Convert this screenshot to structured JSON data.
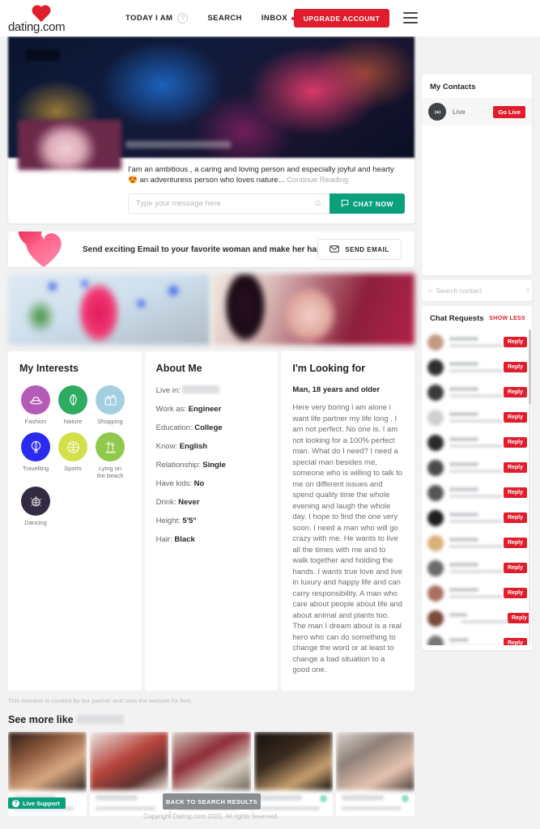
{
  "header": {
    "brand": "dating.com",
    "nav": [
      {
        "label": "TODAY I AM",
        "has_help": true
      },
      {
        "label": "SEARCH",
        "has_help": false
      },
      {
        "label": "INBOX",
        "has_help": false,
        "has_dot": true
      }
    ],
    "upgrade_label": "UPGRADE ACCOUNT"
  },
  "profile": {
    "bio": "I'am an ambitious , a caring and loving person and especially joyful and hearty 😍 an adventuress person who loves nature...",
    "continue_label": "Continue Reading",
    "message_placeholder": "Type your message here",
    "message_value": "",
    "chat_button": "CHAT NOW"
  },
  "email_banner": {
    "text": "Send exciting Email to your favorite woman and make her happy!",
    "button": "SEND EMAIL"
  },
  "interests": {
    "title": "My Interests",
    "items": [
      {
        "label": "Fashion",
        "icon": "hat-icon",
        "color": "#b45bb8"
      },
      {
        "label": "Nature",
        "icon": "leaf-icon",
        "color": "#2eab61"
      },
      {
        "label": "Shopping",
        "icon": "shopping-bags-icon",
        "color": "#a3cfe0"
      },
      {
        "label": "Travelling",
        "icon": "hot-air-balloon-icon",
        "color": "#2b2bf0"
      },
      {
        "label": "Sports",
        "icon": "ball-icon",
        "color": "#d3e04a"
      },
      {
        "label": "Lying on the beach",
        "icon": "palm-tree-icon",
        "color": "#8fc84a"
      },
      {
        "label": "Dancing",
        "icon": "disco-ball-icon",
        "color": "#332b42"
      }
    ]
  },
  "about": {
    "title": "About Me",
    "rows": [
      {
        "label": "Live in:",
        "value": "",
        "redacted": true
      },
      {
        "label": "Work as:",
        "value": "Engineer",
        "redacted": false
      },
      {
        "label": "Education:",
        "value": "College",
        "redacted": false
      },
      {
        "label": "Know:",
        "value": "English",
        "redacted": false
      },
      {
        "label": "Relationship:",
        "value": "Single",
        "redacted": false
      },
      {
        "label": "Have kids:",
        "value": "No",
        "redacted": false
      },
      {
        "label": "Drink:",
        "value": "Never",
        "redacted": false
      },
      {
        "label": "Height:",
        "value": "5'5\"",
        "redacted": false
      },
      {
        "label": "Hair:",
        "value": "Black",
        "redacted": false
      }
    ]
  },
  "looking_for": {
    "title": "I'm Looking for",
    "subtitle": "Man, 18 years and older",
    "body": "Here very boring i am alone i want life partner my life long . I am not perfect. No one is. I am not looking for a 100% perfect man. What do I need? I need a special man besides me, someone who is willing to talk to me on different issues and spend quality time the whole evening and laugh the whole day. I hope to find the one very soon. I need a man who will go crazy with me. He wants to live all the times with me and to walk together and holding the hands. I wants true love and live in luxury and happy life and can carry responsibility. A man who care about people about life and about animal and plants too. The man I dream about is a real hero who can do something to change the word or at least to change a bad situation to a good one."
  },
  "curated_note": "This member is curated by our partner and uses the website for free.",
  "see_more": {
    "title": "See more like",
    "name_redacted": true,
    "cards": [
      {
        "photo_class": "sp1",
        "online": false
      },
      {
        "photo_class": "sp2",
        "online": false
      },
      {
        "photo_class": "sp3",
        "online": true
      },
      {
        "photo_class": "sp4",
        "online": true
      },
      {
        "photo_class": "sp5",
        "online": true
      }
    ]
  },
  "footer": {
    "live_support": "Live Support",
    "back_button": "BACK TO SEARCH RESULTS",
    "copyright": "Copyright Dating.com 2020. All rights reserved"
  },
  "sidebar": {
    "contacts": {
      "title": "My Contacts",
      "live_label": "Live",
      "go_live_label": "Go Live"
    },
    "search": {
      "placeholder": "Search contact",
      "value": ""
    },
    "chat_requests": {
      "title": "Chat Requests",
      "show_less_label": "SHOW LESS",
      "reply_label": "Reply",
      "rows": [
        {
          "avatar_tint": "#c49a86"
        },
        {
          "avatar_tint": "#2e2e2e"
        },
        {
          "avatar_tint": "#3a3a3a"
        },
        {
          "avatar_tint": "#cfcfcf"
        },
        {
          "avatar_tint": "#2a2a2a"
        },
        {
          "avatar_tint": "#4a4a4a"
        },
        {
          "avatar_tint": "#555555"
        },
        {
          "avatar_tint": "#1e1e1e"
        },
        {
          "avatar_tint": "#d8b07a"
        },
        {
          "avatar_tint": "#6a6a6a"
        },
        {
          "avatar_tint": "#a86f62"
        },
        {
          "avatar_tint": "#7a4a3a"
        },
        {
          "avatar_tint": "#777777"
        }
      ]
    }
  },
  "colors": {
    "brand_red": "#e01d2c",
    "chat_green": "#0aa07c",
    "back_gray": "#8a8d91"
  }
}
